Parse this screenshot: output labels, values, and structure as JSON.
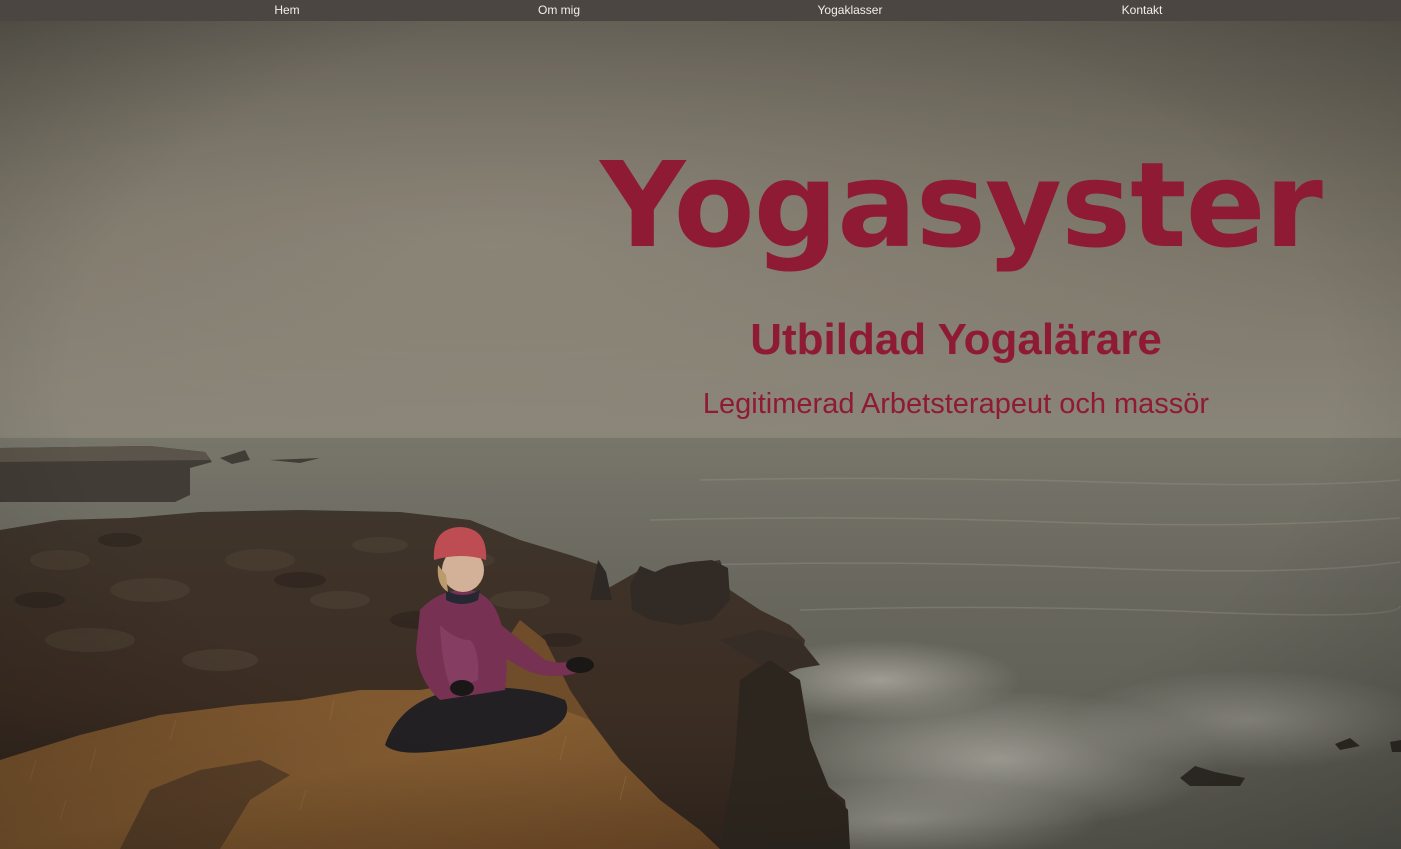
{
  "nav": {
    "items": [
      {
        "label": "Hem"
      },
      {
        "label": "Om mig"
      },
      {
        "label": "Yogaklasser"
      },
      {
        "label": "Kontakt"
      }
    ]
  },
  "hero": {
    "title": "Yogasyster",
    "subtitle": "Utbildad Yogalärare",
    "tagline": "Legitimerad Arbetsterapeut och massör",
    "text_color": "#8f1a33",
    "background": "photo-icon"
  },
  "colors": {
    "nav_bg": "#4c4643",
    "nav_text": "#f2eeea",
    "accent": "#8f1a33"
  }
}
